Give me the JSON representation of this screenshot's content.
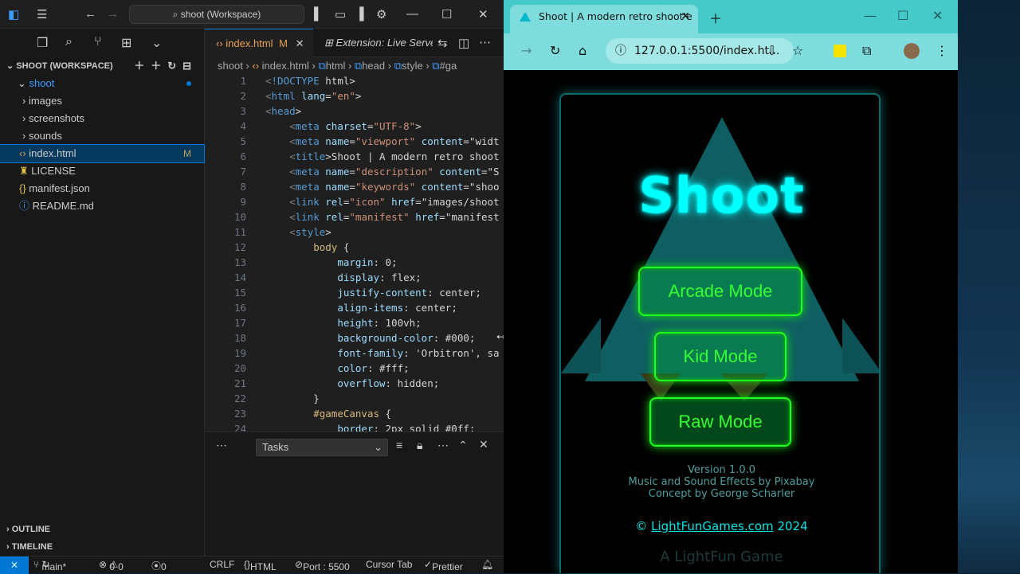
{
  "vscode": {
    "search": "shoot (Workspace)",
    "explorer_title": "SHOOT (WORKSPACE)",
    "tree": [
      {
        "label": "shoot",
        "indent": 1,
        "kind": "folder-open"
      },
      {
        "label": "images",
        "indent": 2,
        "kind": "folder"
      },
      {
        "label": "screenshots",
        "indent": 2,
        "kind": "folder"
      },
      {
        "label": "sounds",
        "indent": 2,
        "kind": "folder"
      },
      {
        "label": "index.html",
        "indent": 2,
        "kind": "html",
        "badge": "M"
      },
      {
        "label": "LICENSE",
        "indent": 2,
        "kind": "license"
      },
      {
        "label": "manifest.json",
        "indent": 2,
        "kind": "json"
      },
      {
        "label": "README.md",
        "indent": 2,
        "kind": "info"
      }
    ],
    "outline": "OUTLINE",
    "timeline": "TIMELINE",
    "tabs": {
      "active": "index.html",
      "active_badge": "M",
      "second": "Extension: Live Serve"
    },
    "breadcrumb": [
      "shoot",
      "index.html",
      "html",
      "head",
      "style",
      "#ga"
    ],
    "code": [
      "<!DOCTYPE html>",
      "<html lang=\"en\">",
      "<head>",
      "    <meta charset=\"UTF-8\">",
      "    <meta name=\"viewport\" content=\"widt",
      "    <title>Shoot | A modern retro shoot",
      "    <meta name=\"description\" content=\"S",
      "    <meta name=\"keywords\" content=\"shoo",
      "    <link rel=\"icon\" href=\"images/shoot",
      "    <link rel=\"manifest\" href=\"manifest",
      "    <style>",
      "        body {",
      "            margin: 0;",
      "            display: flex;",
      "            justify-content: center;",
      "            align-items: center;",
      "            height: 100vh;",
      "            background-color: #000;",
      "            font-family: 'Orbitron', sa",
      "            color: #fff;",
      "            overflow: hidden;",
      "        }",
      "        #gameCanvas {",
      "            border: 2px solid #0ff;"
    ],
    "panel": {
      "select": "Tasks"
    },
    "status": {
      "branch": "main*",
      "errors": "0",
      "warnings": "0",
      "ports": "0",
      "eol": "CRLF",
      "language": "HTML",
      "port": "Port : 5500",
      "cursor": "Cursor Tab",
      "formatter": "Prettier"
    }
  },
  "browser": {
    "tab_title": "Shoot | A modern retro shoot'e",
    "url": "127.0.0.1:5500/index.ht...",
    "game": {
      "title": "Shoot",
      "buttons": [
        "Arcade Mode",
        "Kid Mode",
        "Raw Mode"
      ],
      "version": "Version 1.0.0",
      "music": "Music and Sound Effects by Pixabay",
      "concept": "Concept by George Scharler",
      "copyright_prefix": "©",
      "copyright_link": "LightFunGames.com",
      "copyright_year": "2024",
      "footer": "A LightFun Game"
    }
  },
  "colors": {
    "accent": "#0078d4",
    "neon_cyan": "#00ffff",
    "neon_green": "#1eff1e",
    "chrome_teal": "#7fdcdc"
  }
}
